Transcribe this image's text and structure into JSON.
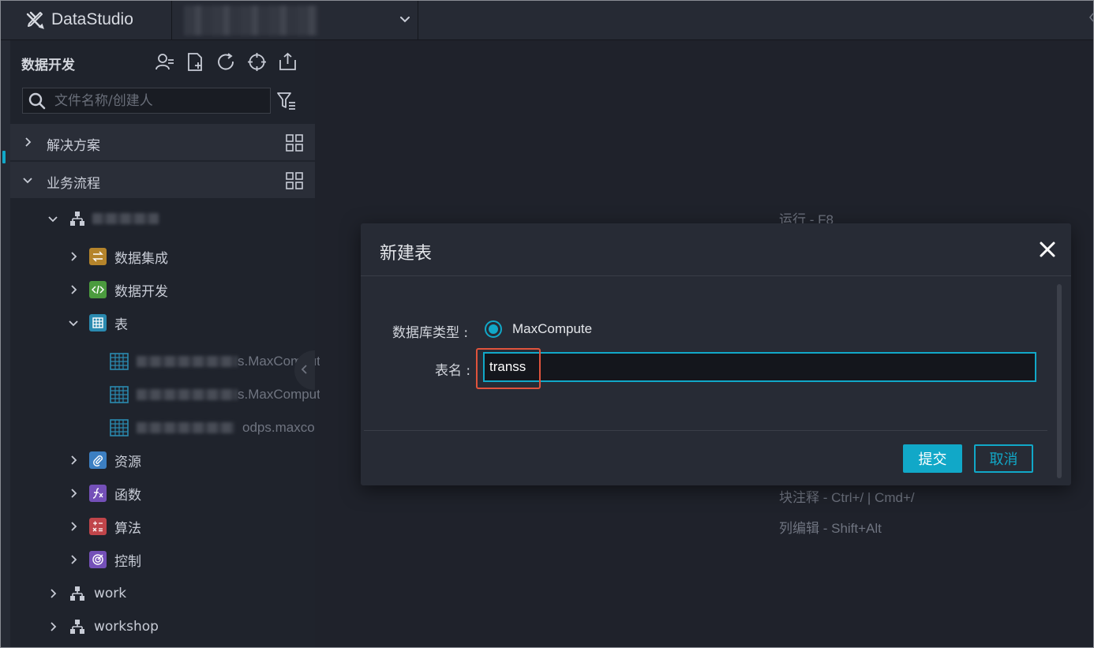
{
  "topbar": {
    "app_name": "DataStudio",
    "logo_icon": "datastudio-logo-icon",
    "project_dropdown_icon": "chevron-down-icon"
  },
  "sidebar": {
    "title": "数据开发",
    "toolbar_icons": [
      "person-icon",
      "new-file-icon",
      "refresh-icon",
      "locate-icon",
      "import-icon"
    ],
    "search_placeholder": "文件名称/创建人",
    "sections": [
      {
        "label": "解决方案",
        "expanded": false
      },
      {
        "label": "业务流程",
        "expanded": true
      }
    ],
    "workflow": {
      "folders": [
        {
          "label": "数据集成",
          "icon": "sync-icon",
          "color": "#b5842b"
        },
        {
          "label": "数据开发",
          "icon": "code-icon",
          "color": "#4b9b3e"
        },
        {
          "label": "表",
          "icon": "table-icon",
          "color": "#2a8ab0"
        }
      ],
      "tables": [
        {
          "suffix": "s.MaxCompute"
        },
        {
          "suffix": "s.MaxCompute"
        },
        {
          "suffix": "odps.maxco"
        }
      ],
      "more_folders": [
        {
          "label": "资源",
          "icon": "paperclip-icon",
          "color": "#3c7fc2"
        },
        {
          "label": "函数",
          "icon": "function-icon",
          "color": "#7450b8"
        },
        {
          "label": "算法",
          "icon": "calculator-icon",
          "color": "#c0454a"
        },
        {
          "label": "控制",
          "icon": "target-icon",
          "color": "#7450b8"
        }
      ]
    },
    "other_workflows": [
      {
        "label": "work"
      },
      {
        "label": "workshop"
      }
    ]
  },
  "main": {
    "hints": [
      {
        "text": "运行 - F8"
      },
      {
        "text": "块注释 - Ctrl+/ | Cmd+/"
      },
      {
        "text": "列编辑 - Shift+Alt"
      }
    ]
  },
  "modal": {
    "title": "新建表",
    "db_type_label": "数据库类型 :",
    "db_type_value": "MaxCompute",
    "table_name_label": "表名 :",
    "table_name_value": "transs",
    "submit_label": "提交",
    "cancel_label": "取消"
  },
  "colors": {
    "accent": "#11a8c8",
    "highlight": "#e0533c"
  }
}
